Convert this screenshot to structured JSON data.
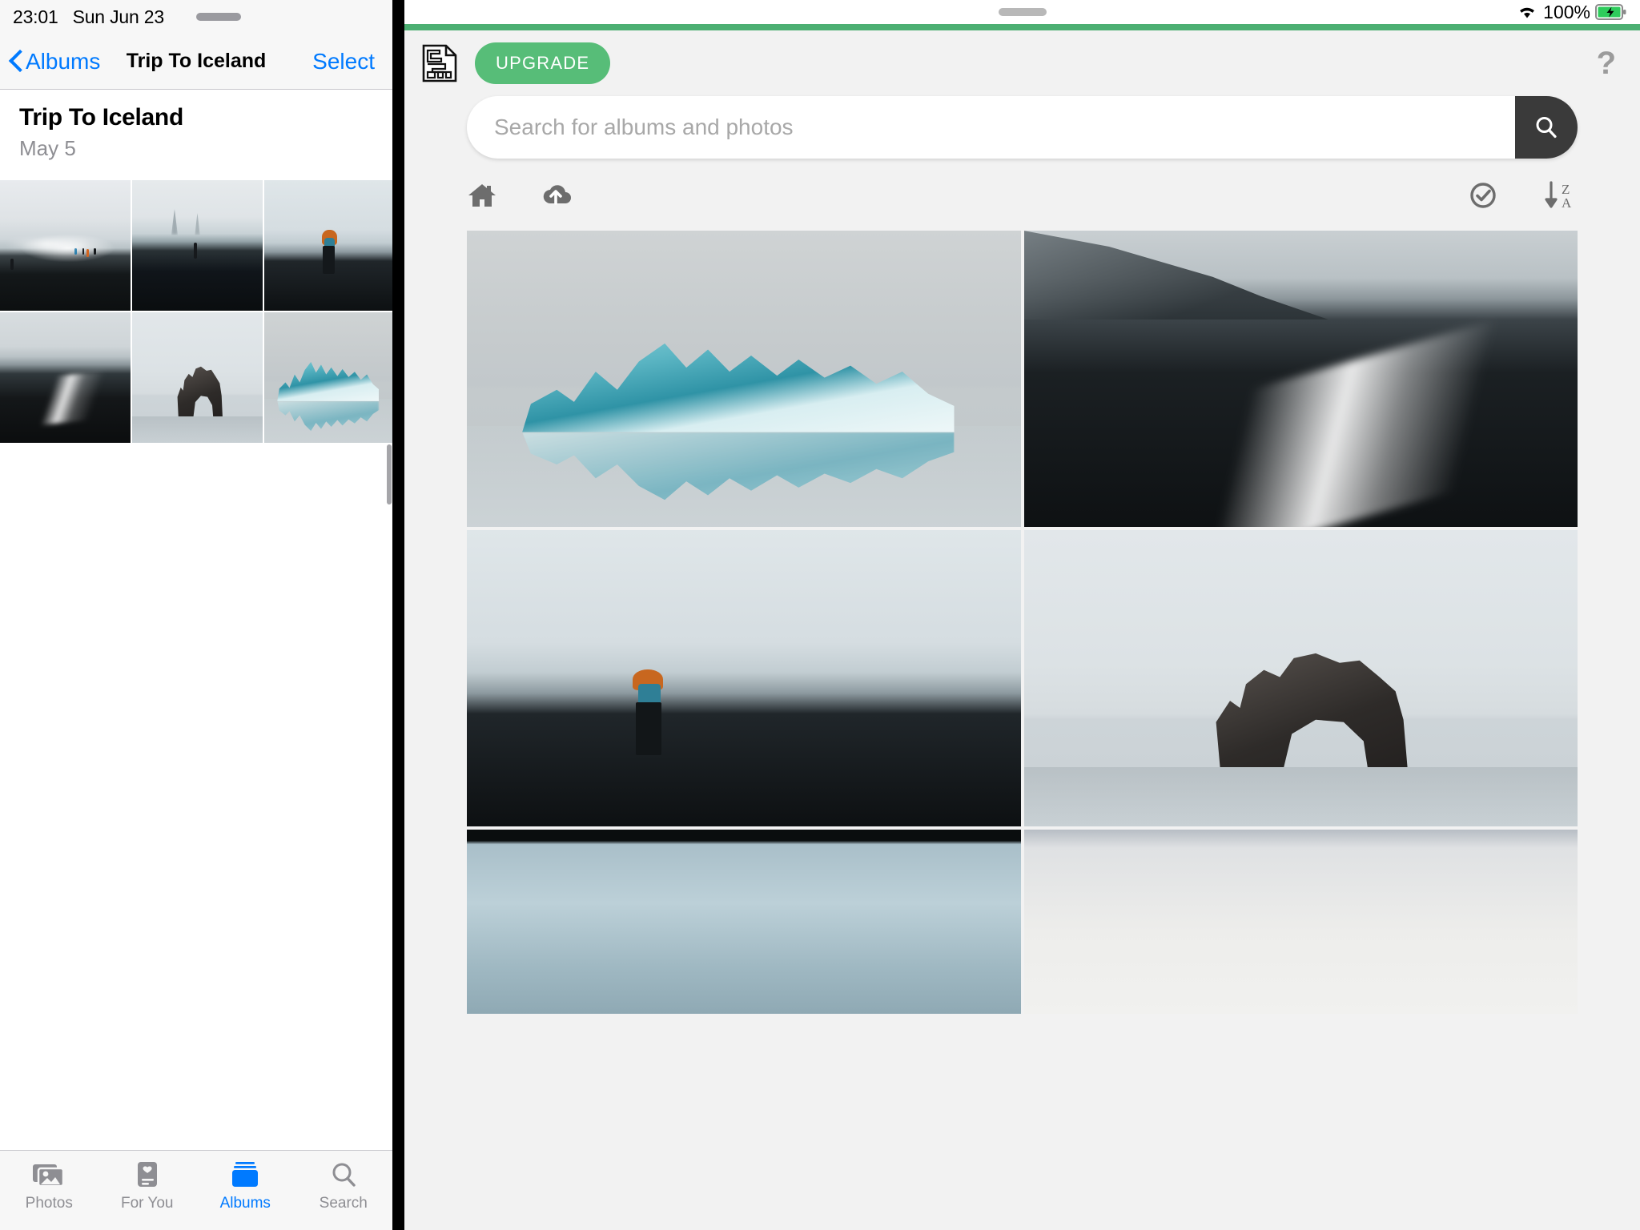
{
  "left_pane": {
    "status_bar": {
      "time": "23:01",
      "date": "Sun Jun 23"
    },
    "nav_bar": {
      "back_label": "Albums",
      "title": "Trip To Iceland",
      "select_label": "Select"
    },
    "album_header": {
      "title": "Trip To Iceland",
      "date": "May 5"
    },
    "photos": [
      {
        "caption": "Black sand beach with distant people"
      },
      {
        "caption": "Foggy sea stacks with lone figure"
      },
      {
        "caption": "Backpacker in orange jacket on shore"
      },
      {
        "caption": "Black sand shoreline with cliffs"
      },
      {
        "caption": "Hvitserkur rock arch in calm water"
      },
      {
        "caption": "Blue iceberg on glacier lagoon"
      }
    ],
    "tab_bar": [
      {
        "label": "Photos",
        "icon": "photos-icon",
        "active": false
      },
      {
        "label": "For You",
        "icon": "for-you-icon",
        "active": false
      },
      {
        "label": "Albums",
        "icon": "albums-icon",
        "active": true
      },
      {
        "label": "Search",
        "icon": "search-icon",
        "active": false
      }
    ]
  },
  "right_pane": {
    "status_bar": {
      "battery_percent": "100%",
      "wifi_icon": "wifi-icon",
      "battery_icon": "battery-charging-icon"
    },
    "app_bar": {
      "logo_icon": "document-maze-logo-icon",
      "upgrade_label": "UPGRADE",
      "help_icon": "question-mark-icon"
    },
    "search": {
      "placeholder": "Search for albums and photos",
      "value": "",
      "button_icon": "search-icon"
    },
    "toolbar": {
      "left": [
        {
          "name": "home-icon",
          "label": "Home"
        },
        {
          "name": "cloud-upload-icon",
          "label": "Upload"
        }
      ],
      "right": [
        {
          "name": "check-circle-icon",
          "label": "Select"
        },
        {
          "name": "sort-za-icon",
          "label": "Sort Z to A"
        }
      ]
    },
    "grid_photos": [
      {
        "caption": "Blue iceberg reflected in glacier lagoon"
      },
      {
        "caption": "Dark cliffs and surf on black beach"
      },
      {
        "caption": "Backpacker in orange jacket on black sand beach"
      },
      {
        "caption": "Hvitserkur rock arch in calm water"
      },
      {
        "caption": "Cloudy blue glacier scene"
      },
      {
        "caption": "Pale overcast landscape"
      }
    ]
  },
  "colors": {
    "ios_accent": "#007aff",
    "ios_bar_bg": "#f7f7f7",
    "android_green": "#57bd78",
    "android_bg": "#f2f2f2",
    "search_button_bg": "#3a3a3a"
  }
}
